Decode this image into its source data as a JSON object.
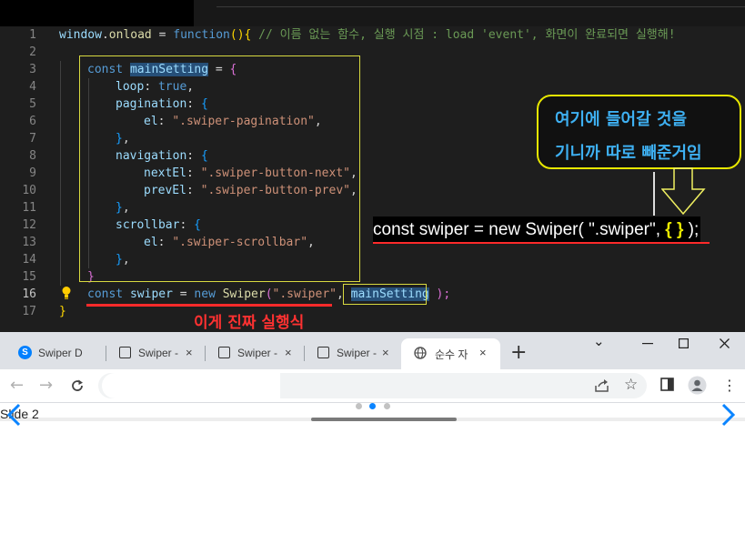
{
  "editor": {
    "line_numbers": [
      "1",
      "2",
      "3",
      "4",
      "5",
      "6",
      "7",
      "8",
      "9",
      "10",
      "11",
      "12",
      "13",
      "14",
      "15",
      "16",
      "17"
    ],
    "active_line": "16",
    "line1": {
      "obj": "window",
      "dot": ".",
      "prop": "onload",
      "eq": " = ",
      "kw": "function",
      "parens": "()",
      "brace": "{",
      "comment": " // 이름 없는 함수, 실행 시점 : load 'event', 화면이 완료되면 실행해!"
    },
    "line3": {
      "kw": "const",
      "name": "mainSetting",
      "eq": " = ",
      "brace": "{"
    },
    "line4": {
      "key": "loop",
      "colon": ": ",
      "value": "true",
      "comma": ","
    },
    "line5": {
      "key": "pagination",
      "colon": ": ",
      "brace": "{"
    },
    "line6": {
      "key": "el",
      "colon": ": ",
      "value": "\".swiper-pagination\"",
      "comma": ","
    },
    "line7": {
      "brace": "}",
      "comma": ","
    },
    "line8": {
      "key": "navigation",
      "colon": ": ",
      "brace": "{"
    },
    "line9": {
      "key": "nextEl",
      "colon": ": ",
      "value": "\".swiper-button-next\"",
      "comma": ","
    },
    "line10": {
      "key": "prevEl",
      "colon": ": ",
      "value": "\".swiper-button-prev\"",
      "comma": ","
    },
    "line11": {
      "brace": "}",
      "comma": ","
    },
    "line12": {
      "key": "scrollbar",
      "colon": ": ",
      "brace": "{"
    },
    "line13": {
      "key": "el",
      "colon": ": ",
      "value": "\".swiper-scrollbar\"",
      "comma": ","
    },
    "line14": {
      "brace": "}",
      "comma": ","
    },
    "line15": {
      "brace": "}"
    },
    "line16": {
      "kw": "const",
      "name": "swiper",
      "eq": " = ",
      "new": "new",
      "cls": "Swiper",
      "open": "(",
      "arg1": "\".swiper\"",
      "comma": ", ",
      "arg2": "mainSetting",
      "close": " );"
    },
    "line17": {
      "brace": "}"
    }
  },
  "annotations": {
    "real_call": "이게 진짜 실행식",
    "bubble_line1": "여기에 들어갈 것을",
    "bubble_line2": "기니까 따로 빼준거임",
    "swiper_call_prefix": "const swiper = new Swiper( \".swiper\", ",
    "swiper_call_obj": "{ }",
    "swiper_call_suffix": " );"
  },
  "browser": {
    "tabs": [
      {
        "label": "Swiper D",
        "close": "×",
        "active": false
      },
      {
        "label": "Swiper -",
        "close": "×",
        "active": false
      },
      {
        "label": "Swiper -",
        "close": "×",
        "active": false
      },
      {
        "label": "Swiper -",
        "close": "×",
        "active": false
      },
      {
        "label": "순수 자",
        "close": "×",
        "active": true
      }
    ],
    "new_tab": "+",
    "window_controls": {
      "minimize": "⌄",
      "maximize": "☐",
      "close": "✕"
    },
    "address": {
      "value": ""
    }
  },
  "page": {
    "slide_label": "Slide 2",
    "pagination_count": 3,
    "pagination_active": 2
  },
  "colors": {
    "editor_bg": "#1e1e1e",
    "highlight_box": "#d8d940",
    "annotation_red": "#ff3131",
    "bubble_text": "#3eb0f2",
    "swiper_accent": "#0a84ff"
  }
}
